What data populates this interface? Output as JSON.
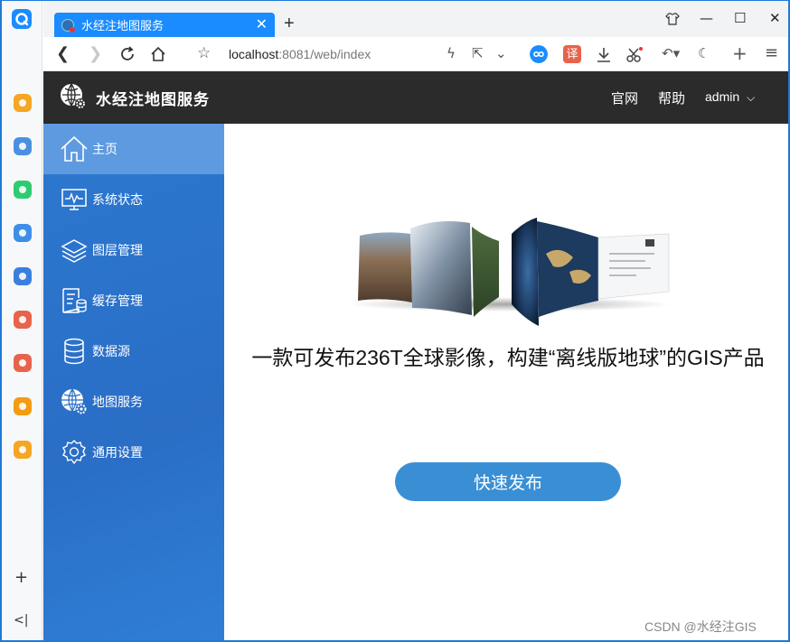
{
  "browser": {
    "tab_title": "水经注地图服务",
    "new_tab": "+",
    "url_host": "localhost",
    "url_rest": ":8081/web/index",
    "window_controls": {
      "restore_icon": "shirt-icon",
      "minimize": "—",
      "maximize": "☐",
      "close": "✕"
    },
    "sidebar_apps": [
      {
        "name": "favorites-icon",
        "color": "#f5a623"
      },
      {
        "name": "history-icon",
        "color": "#4a90e2"
      },
      {
        "name": "wechat-icon",
        "color": "#2ecc71"
      },
      {
        "name": "send-icon",
        "color": "#3d8ee8"
      },
      {
        "name": "cloud-icon",
        "color": "#3a7fe0"
      },
      {
        "name": "pdf-convert-icon",
        "color": "#e8634b"
      },
      {
        "name": "acrobat-icon",
        "color": "#e8634b"
      },
      {
        "name": "search-icon",
        "color": "#f39c12"
      },
      {
        "name": "office-icon",
        "color": "#f5a623"
      }
    ],
    "sidebar_add": "+",
    "sidebar_collapse": "<|"
  },
  "header": {
    "title": "水经注地图服务",
    "links": {
      "official": "官网",
      "help": "帮助"
    },
    "user": "admin"
  },
  "menu": [
    {
      "label": "主页",
      "icon": "home-icon",
      "active": true
    },
    {
      "label": "系统状态",
      "icon": "monitor-icon",
      "active": false
    },
    {
      "label": "图层管理",
      "icon": "layers-icon",
      "active": false
    },
    {
      "label": "缓存管理",
      "icon": "cache-icon",
      "active": false
    },
    {
      "label": "数据源",
      "icon": "database-icon",
      "active": false
    },
    {
      "label": "地图服务",
      "icon": "globe-gear-icon",
      "active": false
    },
    {
      "label": "通用设置",
      "icon": "settings-icon",
      "active": false
    }
  ],
  "main": {
    "tagline": "一款可发布236T全球影像，构建“离线版地球”的GIS产品",
    "quick_publish": "快速发布",
    "watermark": "CSDN @水经注GIS"
  },
  "colors": {
    "accent": "#1a8cff",
    "header_bg": "#2b2b2b",
    "sidebar_bg": "#2a6ec6",
    "sidebar_active": "#5e9ae0",
    "button_bg": "#3a8fd4"
  }
}
